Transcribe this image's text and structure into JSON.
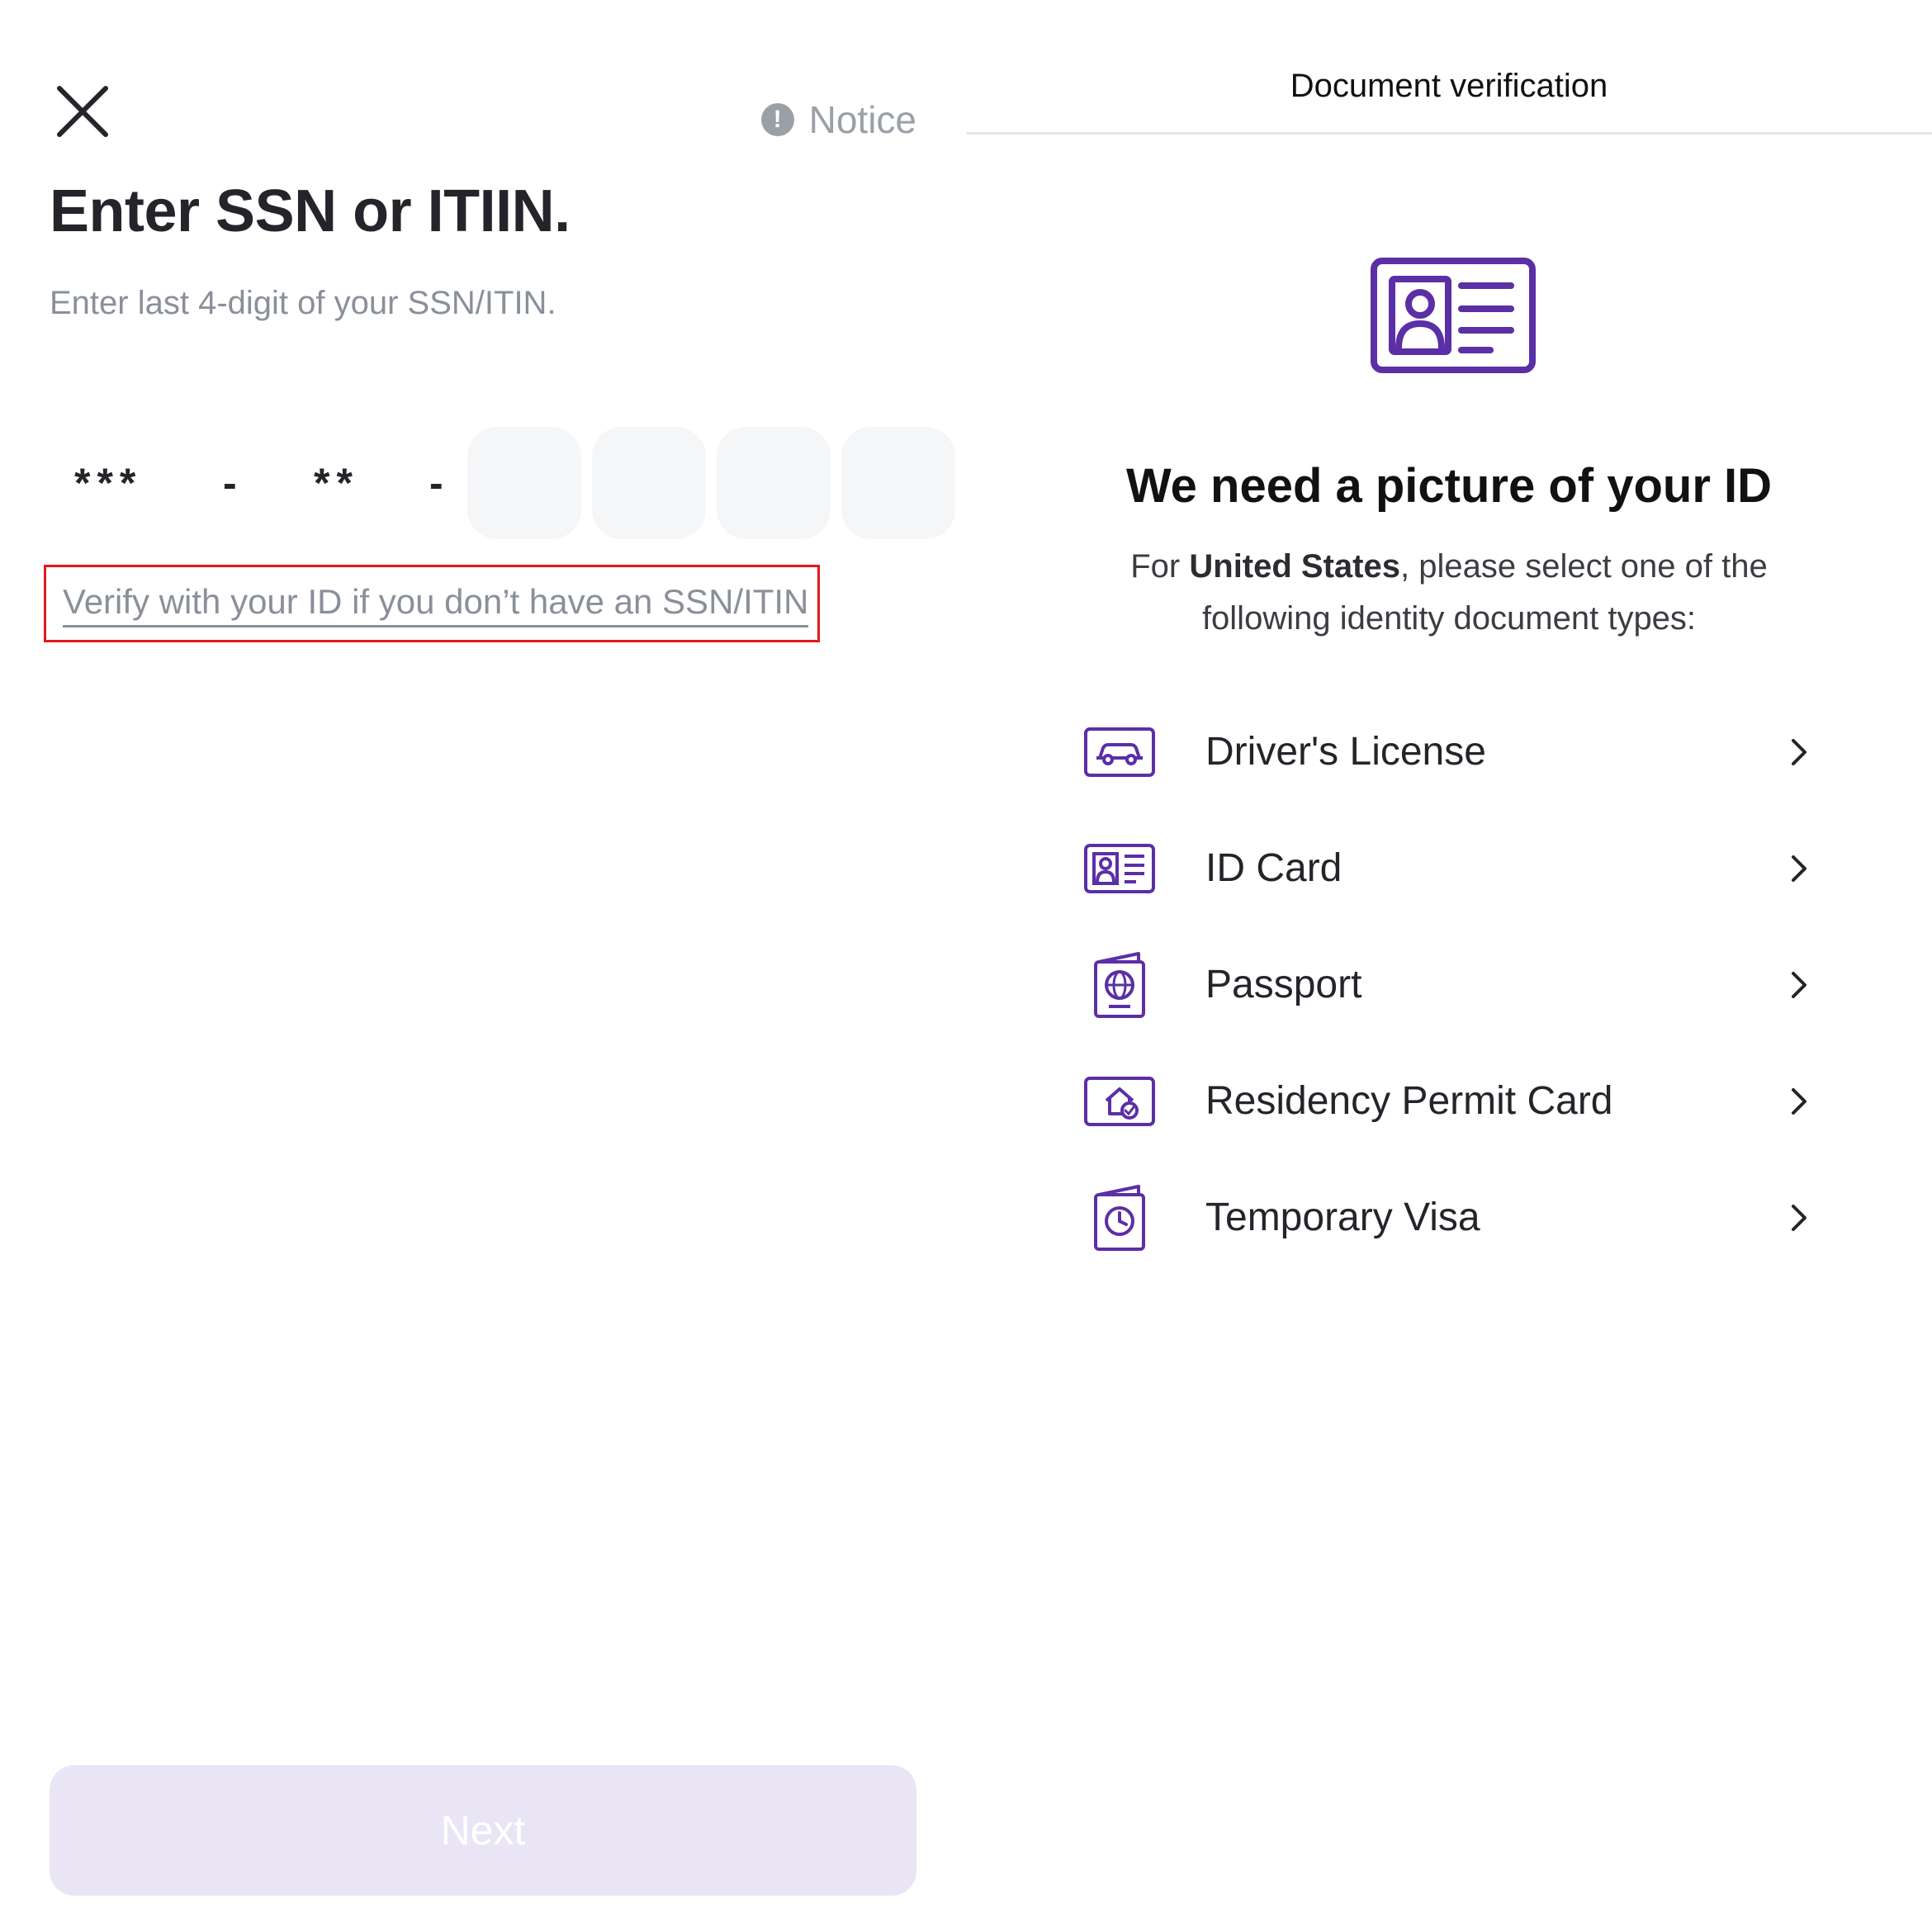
{
  "left": {
    "notice_label": "Notice",
    "notice_icon": "exclamation-circle-icon",
    "title": "Enter SSN or ITIIN.",
    "subtitle": "Enter last 4-digit of your SSN/ITIN.",
    "ssn_mask_area": "***",
    "ssn_mask_group": "**",
    "ssn_dash": "-",
    "ssn_digits": [
      "",
      "",
      "",
      ""
    ],
    "verify_link": "Verify with your ID if you don’t have an SSN/ITIN",
    "next_button": "Next"
  },
  "right": {
    "header_title": "Document verification",
    "headline": "We need a picture of your ID",
    "desc_prefix": "For ",
    "desc_country": "United States",
    "desc_suffix": ", please select one of the following identity document types:",
    "documents": [
      {
        "label": "Driver's License",
        "icon": "car-card-icon"
      },
      {
        "label": "ID Card",
        "icon": "id-card-icon"
      },
      {
        "label": "Passport",
        "icon": "passport-icon"
      },
      {
        "label": "Residency Permit Card",
        "icon": "home-check-card-icon"
      },
      {
        "label": "Temporary Visa",
        "icon": "clock-document-icon"
      }
    ]
  },
  "colors": {
    "accent_purple": "#5b2fa6",
    "highlight_red": "#e0191e",
    "next_disabled_bg": "#e9e5f5",
    "muted_text": "#8a9099"
  }
}
